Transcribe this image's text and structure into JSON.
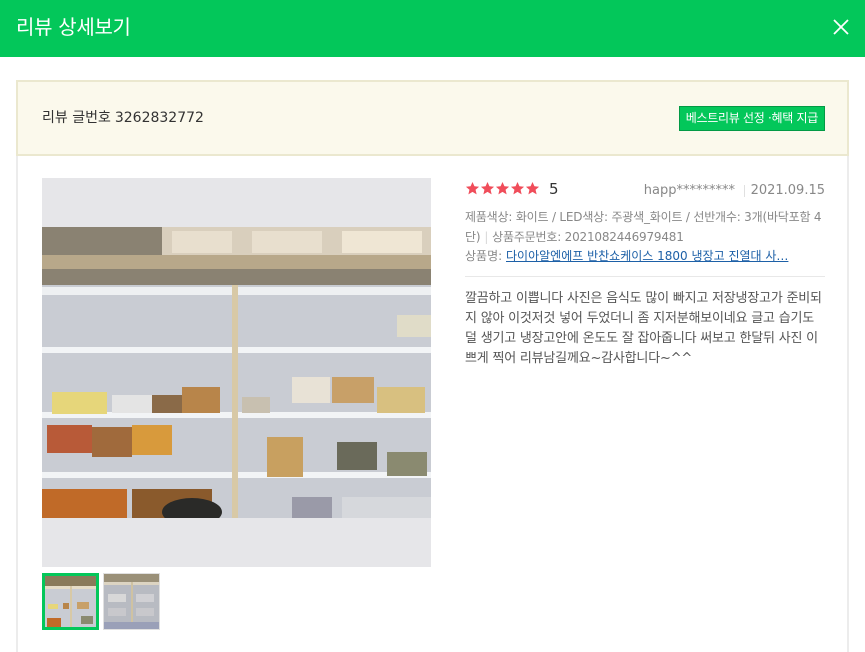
{
  "header": {
    "title": "리뷰 상세보기",
    "close_icon": "close-icon"
  },
  "review_head": {
    "label": "리뷰 글번호",
    "number": "3262832772",
    "best_button": "베스트리뷰 선정 ·혜택 지급"
  },
  "review": {
    "rating": "5",
    "rating_value": 5,
    "author": "happ*********",
    "date": "2021.09.15",
    "options": "제품색상: 화이트 / LED색상: 주광색_화이트 / 선반개수: 3개(바닥포함 4단)",
    "order_label": "상품주문번호: 2021082446979481",
    "product_label": "상품명:",
    "product_name": "다이아알엔에프 반찬쇼케이스 1800 냉장고 진열대 사…",
    "text": "깔끔하고 이쁩니다 사진은 음식도 많이 빠지고 저장냉장고가 준비되지 않아 이것저것 넣어 두었더니 좀 지저분해보이네요 글고 습기도 덜 생기고 냉장고안에 온도도 잘 잡아줍니다 써보고 한달뒤 사진 이쁘게 찍어 리뷰남길께요~감사합니다~^^"
  },
  "colors": {
    "brand_green": "#03c75a",
    "star_red": "#f04d5a",
    "link_blue": "#1d60a7"
  },
  "thumbnails": [
    {
      "label": "photo-1",
      "selected": true
    },
    {
      "label": "photo-2",
      "selected": false
    }
  ]
}
